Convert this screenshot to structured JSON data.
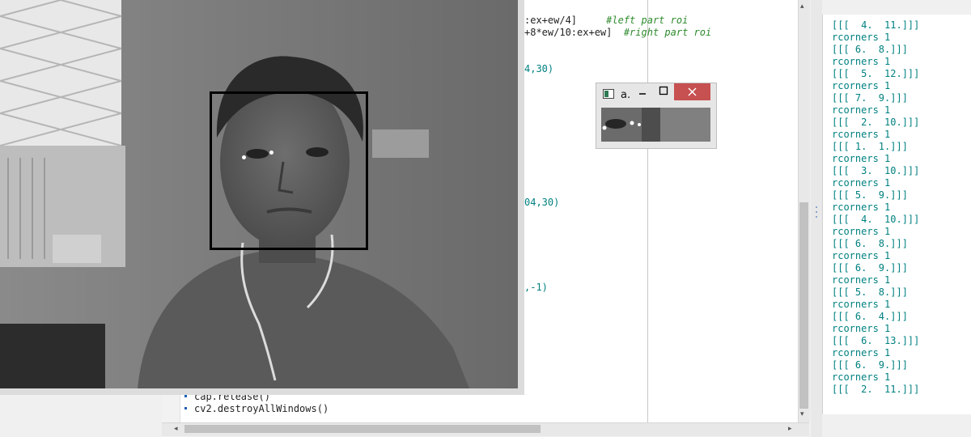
{
  "editor": {
    "code_fragments": [
      {
        "text": ":ex+ew/4]",
        "comment": "#left part roi"
      },
      {
        "text": "+8*ew/10:ex+ew]",
        "comment": "#right part roi"
      },
      {
        "text": "4,30)"
      },
      {
        "text": "04,30)"
      },
      {
        "text": ",-1)"
      }
    ],
    "bottom_lines": [
      "cap.release()",
      "cv2.destroyAllWindows()"
    ]
  },
  "console": {
    "lines": [
      "[[[  4.  11.]]]",
      "rcorners 1",
      "[[[ 6.  8.]]]",
      "rcorners 1",
      "[[[  5.  12.]]]",
      "rcorners 1",
      "[[[ 7.  9.]]]",
      "rcorners 1",
      "[[[  2.  10.]]]",
      "rcorners 1",
      "[[[ 1.  1.]]]",
      "rcorners 1",
      "[[[  3.  10.]]]",
      "rcorners 1",
      "[[[ 5.  9.]]]",
      "rcorners 1",
      "[[[  4.  10.]]]",
      "rcorners 1",
      "[[[ 6.  8.]]]",
      "rcorners 1",
      "[[[ 6.  9.]]]",
      "rcorners 1",
      "[[[ 5.  8.]]]",
      "rcorners 1",
      "[[[ 6.  4.]]]",
      "rcorners 1",
      "[[[  6.  13.]]]",
      "rcorners 1",
      "[[[ 6.  9.]]]",
      "rcorners 1",
      "[[[  2.  11.]]]"
    ]
  },
  "mini_window": {
    "title": "a.",
    "minimize_icon": "minimize-icon",
    "maximize_icon": "maximize-icon",
    "close_icon": "close-icon"
  },
  "icons": {
    "scroll_up": "▴",
    "scroll_down": "▾",
    "scroll_left": "◂",
    "scroll_right": "▸"
  },
  "colors": {
    "code_number": "#008080",
    "code_comment": "#2e8b2e",
    "console_text": "#008080",
    "face_box": "#000000",
    "close_button": "#c75050"
  }
}
